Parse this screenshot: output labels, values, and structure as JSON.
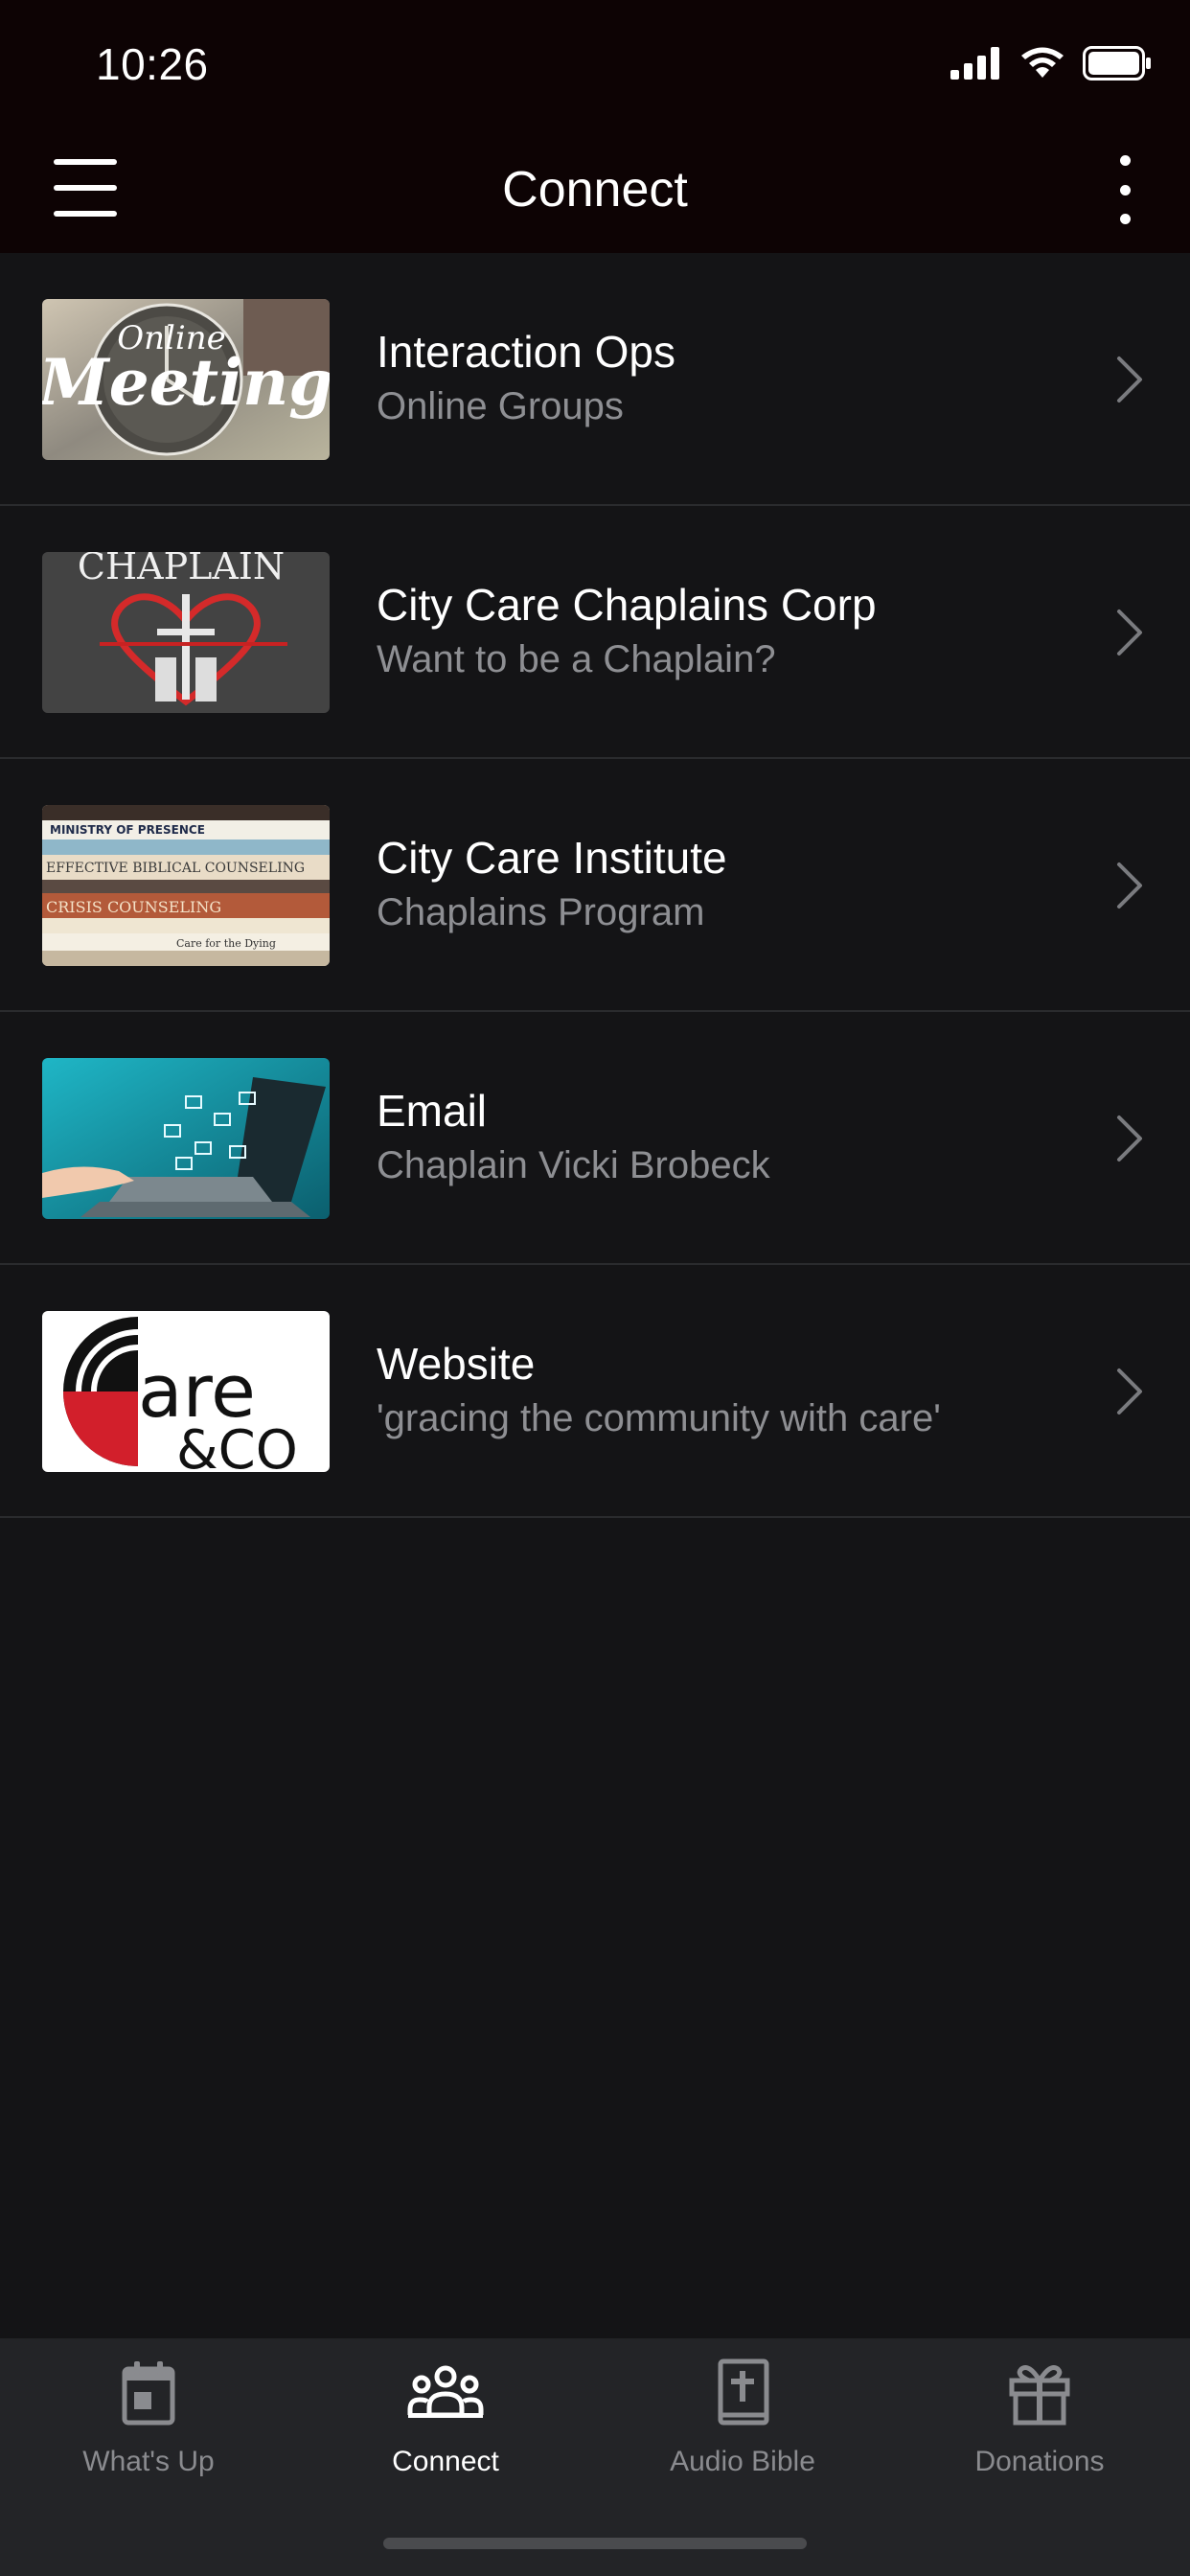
{
  "status_bar": {
    "time": "10:26"
  },
  "nav": {
    "title": "Connect",
    "menu_icon": "hamburger-menu-icon",
    "more_icon": "more-vertical-icon"
  },
  "items": [
    {
      "title": "Interaction Ops",
      "subtitle": "Online Groups",
      "thumbnail_text": [
        "Online",
        "Meeting"
      ]
    },
    {
      "title": "City Care Chaplains Corp",
      "subtitle": "Want to be a Chaplain?",
      "thumbnail_text": [
        "CHAPLAIN"
      ]
    },
    {
      "title": "City Care Institute",
      "subtitle": "Chaplains Program",
      "thumbnail_text": [
        "MINISTRY OF PRESENCE",
        "EFFECTIVE BIBLICAL COUNSELING",
        "CRISIS COUNSELING",
        "Care for the Dying"
      ]
    },
    {
      "title": "Email",
      "subtitle": "Chaplain Vicki Brobeck",
      "thumbnail_text": []
    },
    {
      "title": "Website",
      "subtitle": "'gracing the community with care'",
      "thumbnail_text": [
        "are",
        "&CO"
      ]
    }
  ],
  "tabs": [
    {
      "label": "What's Up",
      "icon": "calendar-icon",
      "active": false
    },
    {
      "label": "Connect",
      "icon": "people-group-icon",
      "active": true
    },
    {
      "label": "Audio Bible",
      "icon": "bible-icon",
      "active": false
    },
    {
      "label": "Donations",
      "icon": "gift-icon",
      "active": false
    }
  ],
  "colors": {
    "background": "#141416",
    "header": "#0d0304",
    "tabbar": "#232427",
    "subtitle": "#8e8f93",
    "active_tab": "#ffffff",
    "inactive_tab": "#8a8b8f"
  }
}
